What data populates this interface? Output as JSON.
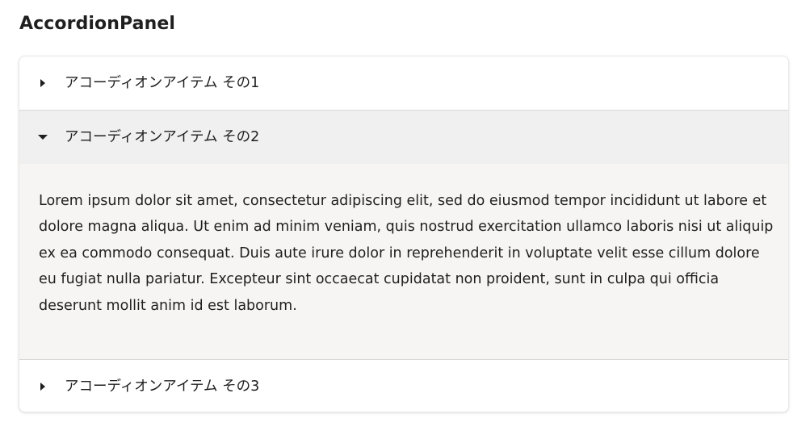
{
  "page": {
    "title": "AccordionPanel"
  },
  "accordion": {
    "items": [
      {
        "label": "アコーディオンアイテム その1",
        "expanded": false,
        "caret_icon": "caret-right-icon"
      },
      {
        "label": "アコーディオンアイテム その2",
        "expanded": true,
        "caret_icon": "caret-down-icon",
        "content": "Lorem ipsum dolor sit amet, consectetur adipiscing elit, sed do eiusmod tempor incididunt ut labore et dolore magna aliqua. Ut enim ad minim veniam, quis nostrud exercitation ullamco laboris nisi ut aliquip ex ea commodo consequat. Duis aute irure dolor in reprehenderit in voluptate velit esse cillum dolore eu fugiat nulla pariatur. Excepteur sint occaecat cupidatat non proident, sunt in culpa qui officia deserunt mollit anim id est laborum."
      },
      {
        "label": "アコーディオンアイテム その3",
        "expanded": false,
        "caret_icon": "caret-right-icon"
      }
    ]
  },
  "colors": {
    "expanded_header_bg": "#f0f0f0",
    "panel_bg": "#f6f5f3",
    "divider": "#d8d8d8",
    "text": "#1f1f1f"
  }
}
